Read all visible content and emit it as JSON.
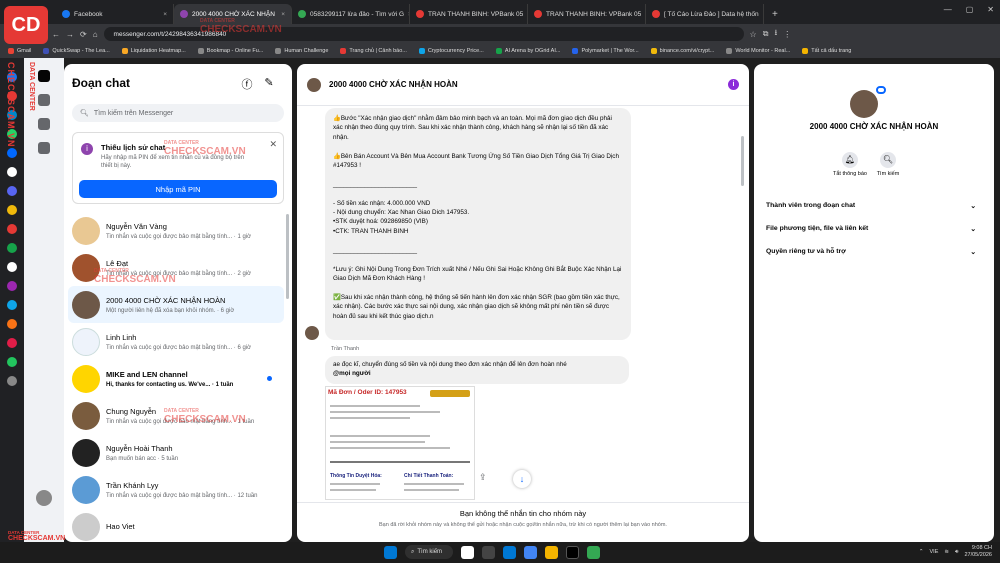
{
  "tabs": [
    {
      "label": "Facebook",
      "color": "#1877f2",
      "active": false
    },
    {
      "label": "2000 4000 CHỜ XÁC NHẬN",
      "color": "#8e44ad",
      "active": true
    },
    {
      "label": "0583299117 lừa đảo - Tìm với G",
      "color": "#34a853",
      "active": false
    },
    {
      "label": "TRAN THANH BINH: VPBank 05",
      "color": "#e53935",
      "active": false
    },
    {
      "label": "TRAN THANH BINH: VPBank 05",
      "color": "#e53935",
      "active": false
    },
    {
      "label": "[ Tố Cáo Lừa Đảo ] Data hệ thốn",
      "color": "#e53935",
      "active": false
    }
  ],
  "logo": "CD",
  "url": "messenger.com/t/24298436341986840",
  "bookmarks": [
    "Gmail",
    "QuickSwap - The Lea...",
    "Liquidation Heatmap...",
    "Bookmap - Online Fu...",
    "Human Challenge",
    "Trang chủ | Cảnh báo...",
    "Cryptocurrency Price...",
    "AI Arena by OGrid AI...",
    "Polymarket | The Wor...",
    "binance.com/vi/crypt...",
    "World Monitor - Real...",
    "Tất cả dấu trang"
  ],
  "watermark": {
    "v1": "CHECKSCAM.VN",
    "v2": "DATA CENTER",
    "main": "CHECKSCAM.VN",
    "sub": "DATA CENTER"
  },
  "list": {
    "title": "Đoạn chat",
    "search_placeholder": "Tìm kiếm trên Messenger",
    "card": {
      "title": "Thiếu lịch sử chat",
      "desc": "Hãy nhập mã PIN để xem tin nhắn cũ và đồng bộ trên thiết bị này.",
      "button": "Nhập mã PIN"
    }
  },
  "chats": [
    {
      "name": "Nguyễn Văn Vàng",
      "preview": "Tin nhắn và cuộc gọi được bảo mật bằng tính... · 1 giờ",
      "color": "#e9c893",
      "selected": false,
      "bold": false
    },
    {
      "name": "Lê Đạt",
      "preview": "Tin nhắn và cuộc gọi được bảo mật bằng tính... · 2 giờ",
      "color": "#a0522d",
      "selected": false,
      "bold": false
    },
    {
      "name": "2000 4000 CHỜ XÁC NHẬN HOÀN",
      "preview": "Một người liên hệ đã xóa bạn khỏi nhóm. · 6 giờ",
      "color": "#6d5848",
      "selected": true,
      "bold": false
    },
    {
      "name": "Linh Linh",
      "preview": "Tin nhắn và cuộc gọi được bảo mật bằng tính... · 6 giờ",
      "color": "#1877f2",
      "selected": false,
      "bold": false
    },
    {
      "name": "MIKE and LEN channel",
      "preview": "Hi, thanks for contacting us. We've... · 1 tuần",
      "color": "#ffd500",
      "selected": false,
      "bold": true
    },
    {
      "name": "Chung Nguyễn",
      "preview": "Tin nhắn và cuộc gọi được bảo mật bằng tính... · 1 tuần",
      "color": "#7a5c3e",
      "selected": false,
      "bold": false
    },
    {
      "name": "Nguyễn Hoài Thanh",
      "preview": "Bạn muốn bán acc · 5 tuần",
      "color": "#222222",
      "selected": false,
      "bold": false
    },
    {
      "name": "Trần Khánh Lyy",
      "preview": "Tin nhắn và cuộc gọi được bảo mật bằng tính... · 12 tuần",
      "color": "#5b9bd5",
      "selected": false,
      "bold": false
    },
    {
      "name": "Hao Viet",
      "preview": "",
      "color": "#cccccc",
      "selected": false,
      "bold": false
    }
  ],
  "conv": {
    "title": "2000 4000 CHỜ XÁC NHẬN HOÀN",
    "message1": "👍Bước \"Xác nhận giao dịch\" nhằm đảm bảo minh bạch và an toàn. Mọi mã đơn giao dịch đều phải xác nhận theo đúng quy trình. Sau khi xác nhận thành công, khách hàng sẽ nhận lại số tiền đã xác nhận.\n\n👍Bên Bán Account Và Bên Mua Account Bank Tương Ứng Số Tiền Giao Dịch Tổng Giá Trị Giao Dịch #147953 !\n\n________________________\n\n- Số tiền xác nhận: 4.000.000 VND\n- Nội dung chuyển: Xac Nhan Giao Dich 147953.\n•STK duyệt hoá: 092869850 (VIB)\n•CTK: TRAN THANH BINH\n\n________________________\n\n*Lưu ý: Ghi Nội Dung Trong Đơn Trích xuất Nhé / Nếu Ghi Sai Hoặc Không Ghi Bắt Buộc Xác Nhận Lại Giao Dịch Mã Đơn Khách Hàng !\n\n✅Sau khi xác nhận thành công, hệ thống sẽ tiến hành lên đơn xác nhận SGR (bao gồm tiền xác thực, xác nhận). Các bước xác thực sai nội dung, xác nhận giao dịch sẽ không mất phí nên tiền sẽ được hoàn đủ sau khi kết thúc giao dịch.n",
    "sender": "Trần Thanh",
    "message2": "ae đọc kĩ, chuyển đúng số tiền và nội dung theo đơn xác nhận để lên đơn hoàn nhé",
    "mention": "@mọi người",
    "image_order": "Mã Đơn / Oder ID: 147953",
    "image_col1": "Thông Tin Duyệt Hóa:",
    "image_col2": "Chi Tiết Thanh Toán:",
    "notice_title": "Bạn không thể nhắn tin cho nhóm này",
    "notice_desc": "Bạn đã rời khỏi nhóm này và không thể gửi hoặc nhận cuộc gọi/tin nhắn nữa, trừ khi có người thêm lại bạn vào nhóm."
  },
  "info": {
    "name": "2000 4000 CHỜ XÁC NHẬN HOÀN",
    "action1": "Tắt thông báo",
    "action2": "Tìm kiếm",
    "sections": [
      "Thành viên trong đoạn chat",
      "File phương tiện, file và liên kết",
      "Quyền riêng tư và hỗ trợ"
    ]
  },
  "taskbar": {
    "search": "Tìm kiếm",
    "lang": "VIE",
    "time": "9:08 CH",
    "date": "27/05/2026"
  }
}
